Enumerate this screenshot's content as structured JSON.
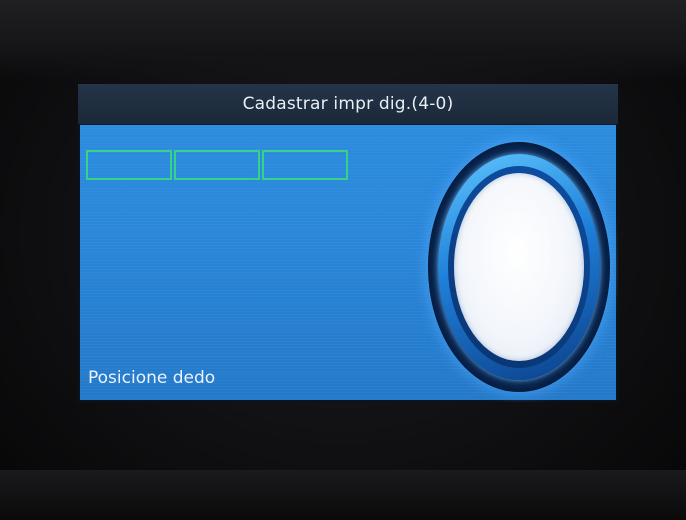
{
  "screen": {
    "title": "Cadastrar impr dig.(4-0)",
    "status_message": "Posicione dedo"
  },
  "enrollment_progress": {
    "total_steps": 3,
    "completed_steps": 0
  },
  "colors": {
    "screen_background": "#2a86d9",
    "title_bar": "#1b2838",
    "progress_outline": "#35d28a",
    "sensor_glow": "#5fc6ff",
    "sensor_pad": "#ffffff"
  },
  "icons": {
    "sensor": "fingerprint-sensor-icon"
  }
}
